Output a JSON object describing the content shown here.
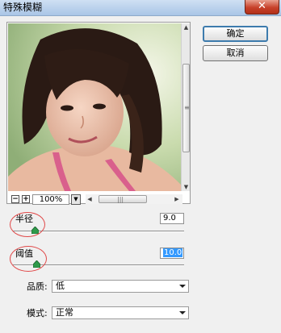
{
  "window": {
    "title": "特殊模糊",
    "close_glyph": "✕"
  },
  "buttons": {
    "ok": "确定",
    "cancel": "取消"
  },
  "zoom": {
    "minus": "−",
    "plus": "+",
    "level": "100%",
    "dropdown_glyph": "▼"
  },
  "scroll": {
    "up": "▲",
    "down": "▼",
    "left": "◀",
    "right": "▶",
    "grip_v": "≡",
    "grip_h": "|||"
  },
  "radius": {
    "label": "半径",
    "value": "9.0",
    "level": 0.09
  },
  "threshold": {
    "label": "阈值",
    "value": "10.0",
    "level": 0.1
  },
  "quality": {
    "label": "品质:",
    "selected": "低"
  },
  "mode": {
    "label": "模式:",
    "selected": "正常"
  },
  "colors": {
    "annotation": "#e04848",
    "default_button_border": "#3d7bad",
    "selection": "#3399ff"
  }
}
